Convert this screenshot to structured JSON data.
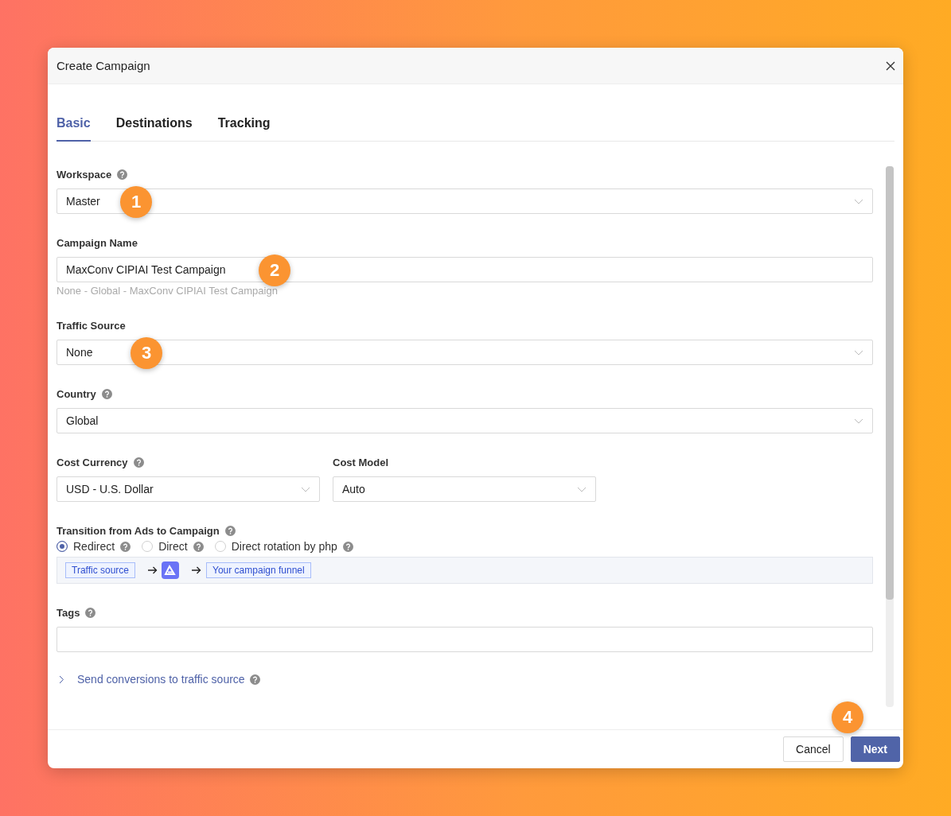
{
  "dialog": {
    "title": "Create Campaign"
  },
  "tabs": [
    {
      "label": "Basic",
      "selected": true
    },
    {
      "label": "Destinations",
      "selected": false
    },
    {
      "label": "Tracking",
      "selected": false
    }
  ],
  "form": [
    {
      "kind": "select",
      "label": "Workspace",
      "help": true,
      "value": "Master",
      "marker": "1"
    },
    {
      "kind": "text",
      "label": "Campaign Name",
      "help": false,
      "value": "MaxConv CIPIAI Test Campaign",
      "hint": "None - Global - MaxConv CIPIAI Test Campaign",
      "marker": "2"
    },
    {
      "kind": "select",
      "label": "Traffic Source",
      "help": false,
      "value": "None",
      "marker": "3"
    },
    {
      "kind": "select",
      "label": "Country",
      "help": true,
      "value": "Global"
    },
    {
      "kind": "pair",
      "items": [
        {
          "kind": "select",
          "label": "Cost Currency",
          "help": true,
          "value": "USD - U.S. Dollar"
        },
        {
          "kind": "select",
          "label": "Cost Model",
          "help": false,
          "value": "Auto"
        }
      ]
    },
    {
      "kind": "radio",
      "label": "Transition from Ads to Campaign",
      "help": true,
      "options": [
        {
          "label": "Redirect",
          "help": true,
          "selected": true
        },
        {
          "label": "Direct",
          "help": true,
          "selected": false
        },
        {
          "label": "Direct rotation by php",
          "help": true,
          "selected": false
        }
      ],
      "flow": {
        "source": "Traffic source",
        "target": "Your campaign funnel"
      }
    },
    {
      "kind": "text",
      "label": "Tags",
      "help": true
    },
    {
      "kind": "collapse",
      "label": "Send conversions to traffic source",
      "help": true,
      "expanded": false
    }
  ],
  "footer": {
    "buttons": [
      {
        "label": "Cancel",
        "kind": "secondary"
      },
      {
        "label": "Next",
        "kind": "primary",
        "marker": "4"
      }
    ]
  }
}
